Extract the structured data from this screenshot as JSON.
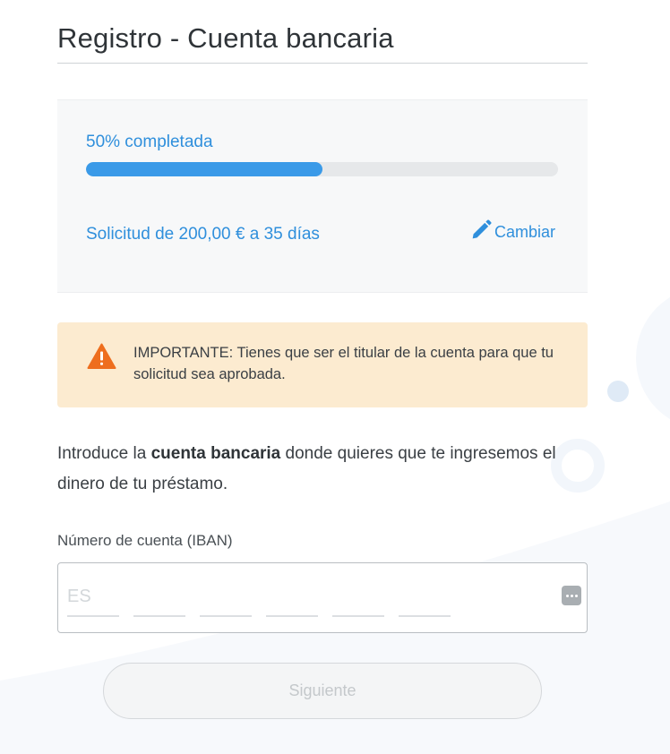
{
  "header": {
    "title": "Registro - Cuenta bancaria"
  },
  "progress": {
    "label": "50% completada",
    "percent": 50,
    "color": "#3a9ae8"
  },
  "request": {
    "summary": "Solicitud de 200,00 € a 35 días",
    "change_label": "Cambiar",
    "change_icon": "pencil-icon"
  },
  "alert": {
    "icon": "warning-icon",
    "text": "IMPORTANTE: Tienes que ser el titular de la cuenta para que tu solicitud sea aprobada.",
    "background": "#fcebd0",
    "icon_color": "#ee6e1e"
  },
  "intro": {
    "before": "Introduce la ",
    "bold": "cuenta bancaria",
    "after": " donde quieres que te ingresemos el dinero de tu préstamo."
  },
  "iban": {
    "label": "Número de cuenta (IBAN)",
    "value": "",
    "placeholder": "ES",
    "more_icon": "more-dots-icon"
  },
  "actions": {
    "next_label": "Siguiente",
    "next_disabled": true
  },
  "colors": {
    "accent": "#2f8fdc"
  }
}
